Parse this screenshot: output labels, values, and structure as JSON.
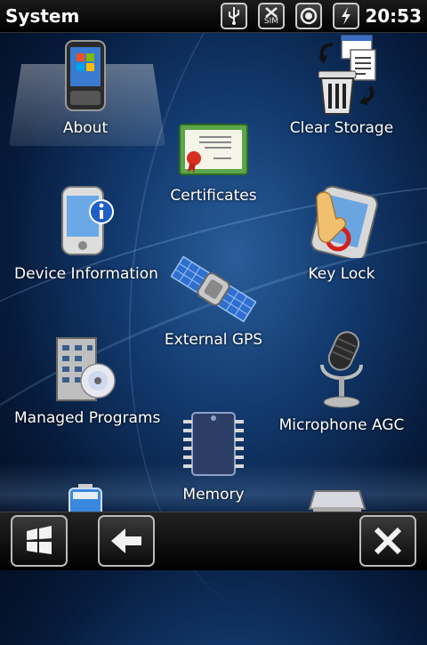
{
  "status": {
    "title": "System",
    "time": "20:53",
    "icons": [
      "usb-icon",
      "no-sim-icon",
      "connection-icon",
      "power-icon"
    ],
    "sim_text": "SIM"
  },
  "items": [
    {
      "name": "about",
      "label": "About",
      "icon": "phone-windows-icon",
      "selected": true
    },
    {
      "name": "clear-storage",
      "label": "Clear Storage",
      "icon": "trash-files-icon"
    },
    {
      "name": "certificates",
      "label": "Certificates",
      "icon": "certificate-icon"
    },
    {
      "name": "device-information",
      "label": "Device Information",
      "icon": "device-info-icon"
    },
    {
      "name": "key-lock",
      "label": "Key Lock",
      "icon": "key-lock-icon"
    },
    {
      "name": "external-gps",
      "label": "External GPS",
      "icon": "satellite-icon"
    },
    {
      "name": "managed-programs",
      "label": "Managed Programs",
      "icon": "building-disc-icon"
    },
    {
      "name": "microphone-agc",
      "label": "Microphone AGC",
      "icon": "microphone-icon"
    },
    {
      "name": "memory",
      "label": "Memory",
      "icon": "memory-chip-icon"
    }
  ],
  "bottom": {
    "buttons": [
      "start-button",
      "back-button",
      "close-button"
    ]
  }
}
